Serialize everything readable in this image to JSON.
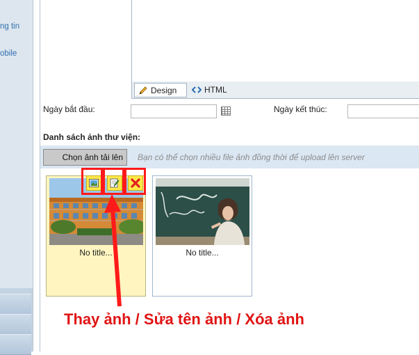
{
  "sidebar": {
    "items": [
      {
        "label": "ng tin"
      },
      {
        "label": "obile"
      }
    ]
  },
  "editor": {
    "tabs": [
      {
        "label": "Design"
      },
      {
        "label": "HTML"
      }
    ]
  },
  "dates": {
    "start_label": "Ngày bắt đầu:",
    "end_label": "Ngày kết thúc:",
    "start_value": "",
    "end_value": ""
  },
  "gallery": {
    "title": "Danh sách ảnh thư viện:",
    "upload_button": "Chọn ảnh tải lên",
    "upload_hint": "Bạn có thể chọn nhiều file ảnh đồng thời để upload lên server",
    "images": [
      {
        "caption": "No title..."
      },
      {
        "caption": "No title..."
      }
    ],
    "actions": [
      {
        "name": "replace-image",
        "icon": "image-icon"
      },
      {
        "name": "rename-image",
        "icon": "edit-icon"
      },
      {
        "name": "delete-image",
        "icon": "delete-x-icon"
      }
    ]
  },
  "annotation": {
    "text": "Thay ảnh / Sửa tên ảnh / Xóa ảnh",
    "color": "#e01414"
  },
  "colors": {
    "accent_red": "#ff1a1a",
    "action_yellow": "#ffe84a",
    "selected_bg": "#fff5c0",
    "upload_bar": "#dbe7f3"
  }
}
